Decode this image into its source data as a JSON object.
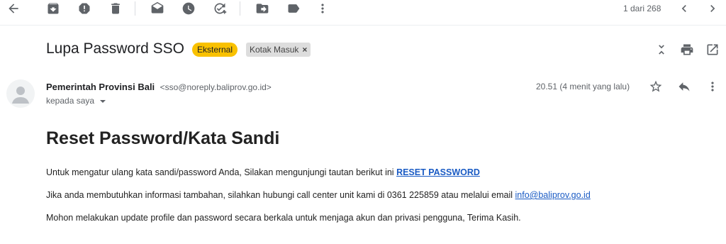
{
  "toolbar": {
    "items": [
      {
        "name": "back-arrow-icon",
        "label": "Kembali"
      },
      {
        "name": "archive-icon",
        "label": "Arsipkan"
      },
      {
        "name": "report-spam-icon",
        "label": "Laporkan spam"
      },
      {
        "name": "delete-icon",
        "label": "Hapus"
      },
      {
        "name": "mark-unread-icon",
        "label": "Tandai belum dibaca"
      },
      {
        "name": "snooze-icon",
        "label": "Tunda"
      },
      {
        "name": "add-task-icon",
        "label": "Tambahkan ke Tugas"
      },
      {
        "name": "move-to-icon",
        "label": "Pindahkan ke"
      },
      {
        "name": "label-icon",
        "label": "Label"
      },
      {
        "name": "more-vert-icon",
        "label": "Lainnya"
      }
    ],
    "pager": "1 dari 268"
  },
  "message": {
    "subject": "Lupa Password SSO",
    "badges": {
      "external": "Eksternal",
      "inbox": "Kotak Masuk",
      "remove": "×"
    },
    "sender": {
      "name": "Pemerintah Provinsi Bali",
      "email": "<sso@noreply.baliprov.go.id>"
    },
    "to": "kepada saya",
    "time": "20.51 (4 menit yang lalu)",
    "body": {
      "title": "Reset Password/Kata Sandi",
      "p1_text": "Untuk mengatur ulang kata sandi/password Anda, Silakan mengunjungi tautan berikut ini ",
      "p1_link": "RESET PASSWORD",
      "p2_text": "Jika anda membutuhkan informasi tambahan, silahkan hubungi call center unit kami di 0361 225859 atau melalui email ",
      "p2_link": "info@baliprov.go.id",
      "p3_text": "Mohon melakukan update profile dan password secara berkala untuk menjaga akun dan privasi pengguna, Terima Kasih."
    }
  },
  "colors": {
    "external_badge": "#f9c100",
    "link": "#1a5bc4",
    "icon": "#5f6368"
  }
}
